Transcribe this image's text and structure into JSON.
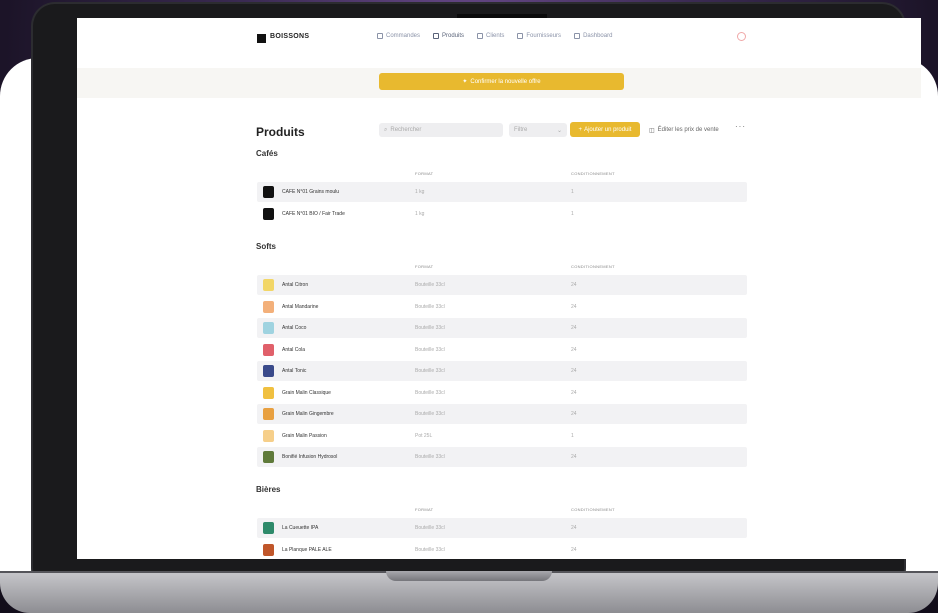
{
  "app": {
    "logo": "BOISSONS",
    "nav": [
      {
        "label": "Commandes",
        "active": false
      },
      {
        "label": "Produits",
        "active": true
      },
      {
        "label": "Clients",
        "active": false
      },
      {
        "label": "Fournisseurs",
        "active": false
      },
      {
        "label": "Dashboard",
        "active": false
      }
    ],
    "banner": "Confirmer la nouvelle offre"
  },
  "toolbar": {
    "title": "Produits",
    "search_placeholder": "Rechercher",
    "filter_label": "Filtre",
    "add_label": "Ajouter un produit",
    "prices_label": "Éditer les prix de vente",
    "more_label": "···"
  },
  "sections": [
    {
      "title": "Cafés",
      "columns": {
        "format": "FORMAT",
        "cond": "CONDITIONNEMENT"
      },
      "rows": [
        {
          "name": "CAFE N°01 Grains moulu",
          "format": "1 kg",
          "cond": "1",
          "color": "#111111"
        },
        {
          "name": "CAFE N°01 BIO / Fair Trade",
          "format": "1 kg",
          "cond": "1",
          "color": "#111111"
        }
      ]
    },
    {
      "title": "Softs",
      "columns": {
        "format": "FORMAT",
        "cond": "CONDITIONNEMENT"
      },
      "rows": [
        {
          "name": "Antal Citron",
          "format": "Bouteille 33cl",
          "cond": "24",
          "color": "#f2d667"
        },
        {
          "name": "Antal Mandarine",
          "format": "Bouteille 33cl",
          "cond": "24",
          "color": "#f3b07a"
        },
        {
          "name": "Antal Coco",
          "format": "Bouteille 33cl",
          "cond": "24",
          "color": "#9fd3e0"
        },
        {
          "name": "Antal Cola",
          "format": "Bouteille 33cl",
          "cond": "24",
          "color": "#e0606a"
        },
        {
          "name": "Antal Tonic",
          "format": "Bouteille 33cl",
          "cond": "24",
          "color": "#3a4a8a"
        },
        {
          "name": "Grain Malin Classique",
          "format": "Bouteille 33cl",
          "cond": "24",
          "color": "#f0c040"
        },
        {
          "name": "Grain Malin Gingembre",
          "format": "Bouteille 33cl",
          "cond": "24",
          "color": "#e8a040"
        },
        {
          "name": "Grain Malin Passion",
          "format": "Pot 25L",
          "cond": "1",
          "color": "#f6cf8a"
        },
        {
          "name": "Bonifié Infusion Hydrosol",
          "format": "Bouteille 33cl",
          "cond": "24",
          "color": "#5f7a3a"
        }
      ]
    },
    {
      "title": "Bières",
      "columns": {
        "format": "FORMAT",
        "cond": "CONDITIONNEMENT"
      },
      "rows": [
        {
          "name": "La Cueuette IPA",
          "format": "Bouteille 33cl",
          "cond": "24",
          "color": "#2e8a6a"
        },
        {
          "name": "La Planque PALE ALE",
          "format": "Bouteille 33cl",
          "cond": "24",
          "color": "#c0562a"
        }
      ]
    }
  ]
}
